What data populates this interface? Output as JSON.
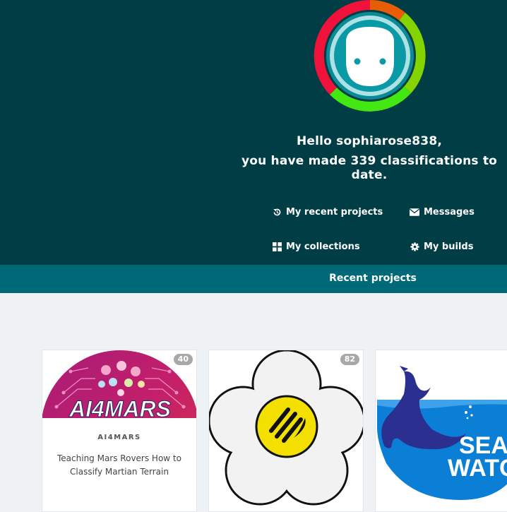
{
  "user": {
    "greeting_line1": "Hello sophiarose838,",
    "greeting_line2": "you have made 339 classifications to date."
  },
  "nav": {
    "recent_projects": "My recent projects",
    "messages": "Messages",
    "collections": "My collections",
    "builds": "My builds"
  },
  "recent_section": {
    "label": "Recent projects"
  },
  "projects": [
    {
      "badge": "40",
      "title": "AI4MARS",
      "description": "Teaching Mars Rovers How to Classify Martian Terrain",
      "logo_text": "AI4MARS"
    },
    {
      "badge": "82",
      "title": "",
      "description": ""
    },
    {
      "badge": "",
      "title": "",
      "description": "",
      "logo_text_1": "SEAL",
      "logo_text_2": "WATCH"
    }
  ],
  "colors": {
    "hero_bg": "#003d45",
    "recent_bar_bg": "#006977",
    "page_bg": "#eef2f5",
    "badge_bg": "#a8a8a8"
  },
  "icons": {
    "recent_projects": "history-icon",
    "messages": "envelope-icon",
    "collections": "grid-icon",
    "builds": "gear-icon"
  }
}
